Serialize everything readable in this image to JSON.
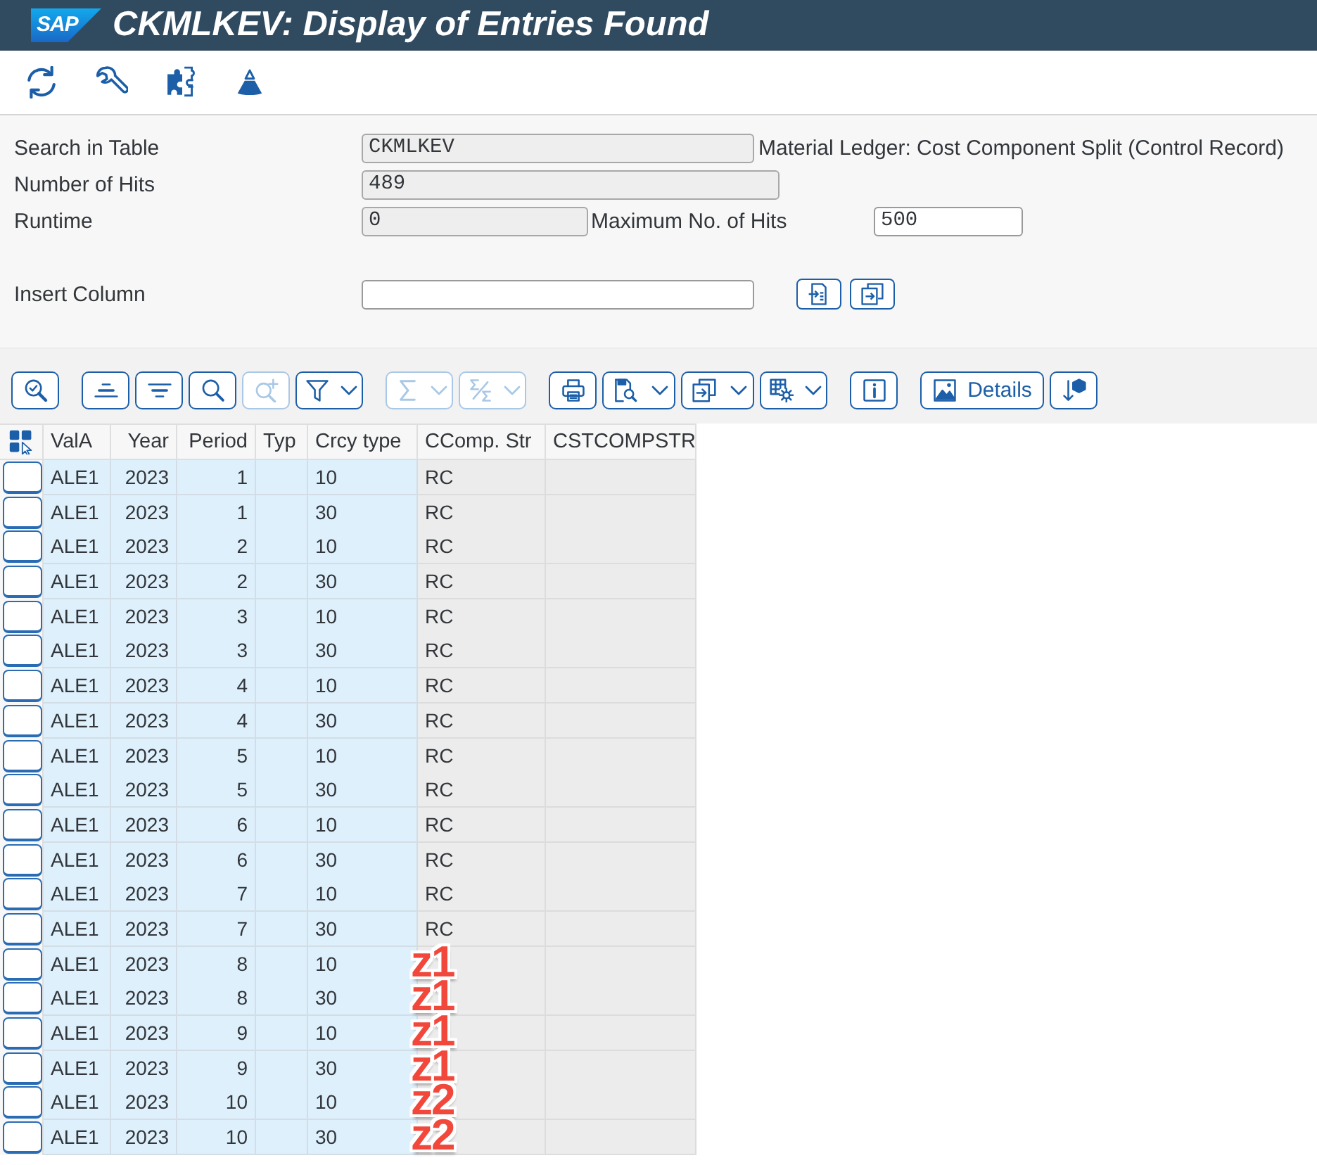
{
  "window": {
    "logo": "SAP",
    "title": "CKMLKEV: Display of Entries Found"
  },
  "form": {
    "search_in_table": {
      "label": "Search in Table",
      "value": "CKMLKEV",
      "readonly": true,
      "description": "Material Ledger: Cost Component Split (Control Record)"
    },
    "number_of_hits": {
      "label": "Number of Hits",
      "value": "489",
      "readonly": true
    },
    "runtime": {
      "label": "Runtime",
      "value": "0",
      "readonly": true
    },
    "maximum_no_of_hits": {
      "label": "Maximum No. of Hits",
      "value": "500",
      "readonly": false
    },
    "insert_column": {
      "label": "Insert Column",
      "readonly": false
    }
  },
  "alv_toolbar": [
    {
      "buttons": [
        {
          "kind": "select",
          "disabled": false,
          "has_menu": false,
          "split": false
        }
      ]
    },
    {
      "buttons": [
        {
          "kind": "sort_ascending",
          "disabled": false,
          "has_menu": false,
          "split": false
        },
        {
          "kind": "sort_descending",
          "disabled": false,
          "has_menu": false,
          "split": false
        },
        {
          "kind": "find",
          "disabled": false,
          "has_menu": false,
          "split": false
        },
        {
          "kind": "find_next",
          "disabled": true,
          "has_menu": false,
          "split": false
        },
        {
          "kind": "filter",
          "disabled": false,
          "has_menu": true,
          "split": true
        }
      ]
    },
    {
      "buttons": [
        {
          "kind": "total",
          "disabled": true,
          "has_menu": true,
          "split": true
        },
        {
          "kind": "subtotal",
          "disabled": true,
          "has_menu": true,
          "split": true
        }
      ]
    },
    {
      "buttons": [
        {
          "kind": "print",
          "disabled": false,
          "has_menu": false,
          "split": false
        },
        {
          "kind": "view",
          "disabled": false,
          "has_menu": true,
          "split": false
        },
        {
          "kind": "export",
          "disabled": false,
          "has_menu": true,
          "split": false
        },
        {
          "kind": "layout",
          "disabled": false,
          "has_menu": true,
          "split": true
        }
      ]
    },
    {
      "buttons": [
        {
          "kind": "info",
          "disabled": false,
          "has_menu": false,
          "split": false
        }
      ]
    },
    {
      "buttons": [
        {
          "kind": "details",
          "label": "Details",
          "disabled": false,
          "has_menu": false,
          "split": false
        },
        {
          "kind": "graphic",
          "disabled": false,
          "has_menu": false,
          "split": false
        }
      ]
    }
  ],
  "table": {
    "columns": [
      {
        "label": "ValA",
        "key": true,
        "kind": "text"
      },
      {
        "label": "Year",
        "key": true,
        "kind": "number"
      },
      {
        "label": "Period",
        "key": true,
        "kind": "number"
      },
      {
        "label": "Typ",
        "key": true,
        "kind": "text"
      },
      {
        "label": "Crcy type",
        "key": true,
        "kind": "text"
      },
      {
        "label": "CComp. Str",
        "key": false,
        "kind": "text"
      },
      {
        "label": "CSTCOMPSTR",
        "key": false,
        "kind": "text"
      }
    ],
    "rows": [
      {
        "selected": false,
        "vala": "ALE1",
        "year": "2023",
        "period": "1",
        "crcy_type": "10",
        "ccomp_str": "RC"
      },
      {
        "selected": false,
        "vala": "ALE1",
        "year": "2023",
        "period": "1",
        "crcy_type": "30",
        "ccomp_str": "RC"
      },
      {
        "selected": false,
        "vala": "ALE1",
        "year": "2023",
        "period": "2",
        "crcy_type": "10",
        "ccomp_str": "RC"
      },
      {
        "selected": false,
        "vala": "ALE1",
        "year": "2023",
        "period": "2",
        "crcy_type": "30",
        "ccomp_str": "RC"
      },
      {
        "selected": false,
        "vala": "ALE1",
        "year": "2023",
        "period": "3",
        "crcy_type": "10",
        "ccomp_str": "RC"
      },
      {
        "selected": false,
        "vala": "ALE1",
        "year": "2023",
        "period": "3",
        "crcy_type": "30",
        "ccomp_str": "RC"
      },
      {
        "selected": false,
        "vala": "ALE1",
        "year": "2023",
        "period": "4",
        "crcy_type": "10",
        "ccomp_str": "RC"
      },
      {
        "selected": false,
        "vala": "ALE1",
        "year": "2023",
        "period": "4",
        "crcy_type": "30",
        "ccomp_str": "RC"
      },
      {
        "selected": false,
        "vala": "ALE1",
        "year": "2023",
        "period": "5",
        "crcy_type": "10",
        "ccomp_str": "RC"
      },
      {
        "selected": false,
        "vala": "ALE1",
        "year": "2023",
        "period": "5",
        "crcy_type": "30",
        "ccomp_str": "RC"
      },
      {
        "selected": false,
        "vala": "ALE1",
        "year": "2023",
        "period": "6",
        "crcy_type": "10",
        "ccomp_str": "RC"
      },
      {
        "selected": false,
        "vala": "ALE1",
        "year": "2023",
        "period": "6",
        "crcy_type": "30",
        "ccomp_str": "RC"
      },
      {
        "selected": false,
        "vala": "ALE1",
        "year": "2023",
        "period": "7",
        "crcy_type": "10",
        "ccomp_str": "RC"
      },
      {
        "selected": false,
        "vala": "ALE1",
        "year": "2023",
        "period": "7",
        "crcy_type": "30",
        "ccomp_str": "RC"
      },
      {
        "selected": false,
        "vala": "ALE1",
        "year": "2023",
        "period": "8",
        "crcy_type": "10",
        "annotation": "z1"
      },
      {
        "selected": false,
        "vala": "ALE1",
        "year": "2023",
        "period": "8",
        "crcy_type": "30",
        "annotation": "z1"
      },
      {
        "selected": false,
        "vala": "ALE1",
        "year": "2023",
        "period": "9",
        "crcy_type": "10",
        "annotation": "z1"
      },
      {
        "selected": false,
        "vala": "ALE1",
        "year": "2023",
        "period": "9",
        "crcy_type": "30",
        "annotation": "z1"
      },
      {
        "selected": false,
        "vala": "ALE1",
        "year": "2023",
        "period": "10",
        "crcy_type": "10",
        "annotation": "z2"
      },
      {
        "selected": false,
        "vala": "ALE1",
        "year": "2023",
        "period": "10",
        "crcy_type": "30",
        "annotation": "z2"
      }
    ]
  }
}
